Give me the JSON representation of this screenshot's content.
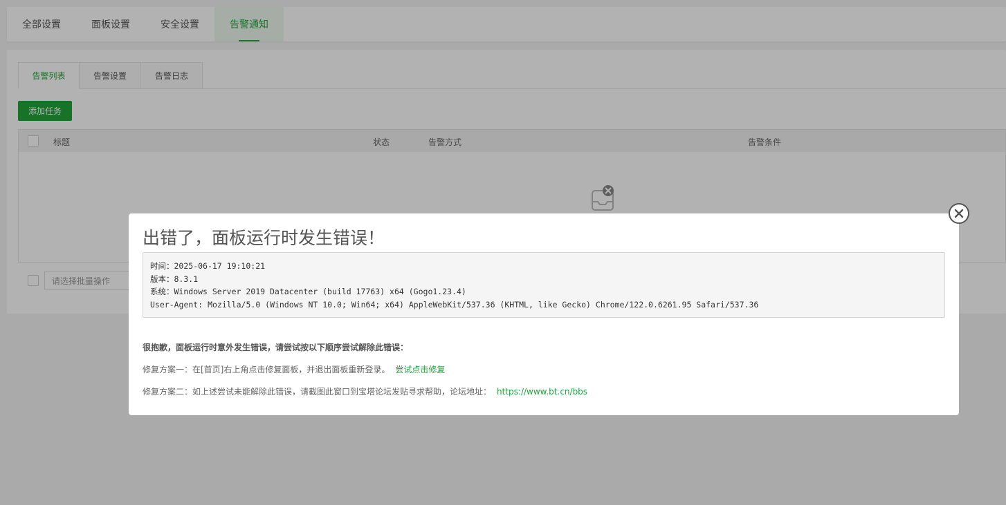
{
  "top_tabs": [
    {
      "label": "全部设置"
    },
    {
      "label": "面板设置"
    },
    {
      "label": "安全设置"
    },
    {
      "label": "告警通知"
    }
  ],
  "sub_tabs": [
    {
      "label": "告警列表"
    },
    {
      "label": "告警设置"
    },
    {
      "label": "告警日志"
    }
  ],
  "add_button": "添加任务",
  "table": {
    "columns": [
      "标题",
      "状态",
      "告警方式",
      "告警条件"
    ]
  },
  "batch_select_placeholder": "请选择批量操作",
  "dialog": {
    "title": "出错了，面板运行时发生错误！",
    "info": {
      "time": "时间：2025-06-17 19:10:21",
      "version": "版本：8.3.1",
      "system": "系统：Windows Server 2019 Datacenter (build 17763) x64 (Gogo1.23.4)",
      "user_agent": "User-Agent: Mozilla/5.0 (Windows NT 10.0; Win64; x64) AppleWebKit/537.36 (KHTML, like Gecko) Chrome/122.0.6261.95 Safari/537.36"
    },
    "sorry": "很抱歉，面板运行时意外发生错误，请尝试按以下顺序尝试解除此错误：",
    "fix1_text": "修复方案一：在[首页]右上角点击修复面板，并退出面板重新登录。",
    "fix1_link": "尝试点击修复",
    "fix2_text": "修复方案二：如上述尝试未能解除此错误，请截图此窗口到宝塔论坛发贴寻求帮助，论坛地址：",
    "fix2_link": "https://www.bt.cn/bbs"
  },
  "colors": {
    "accent": "#20a53a"
  }
}
